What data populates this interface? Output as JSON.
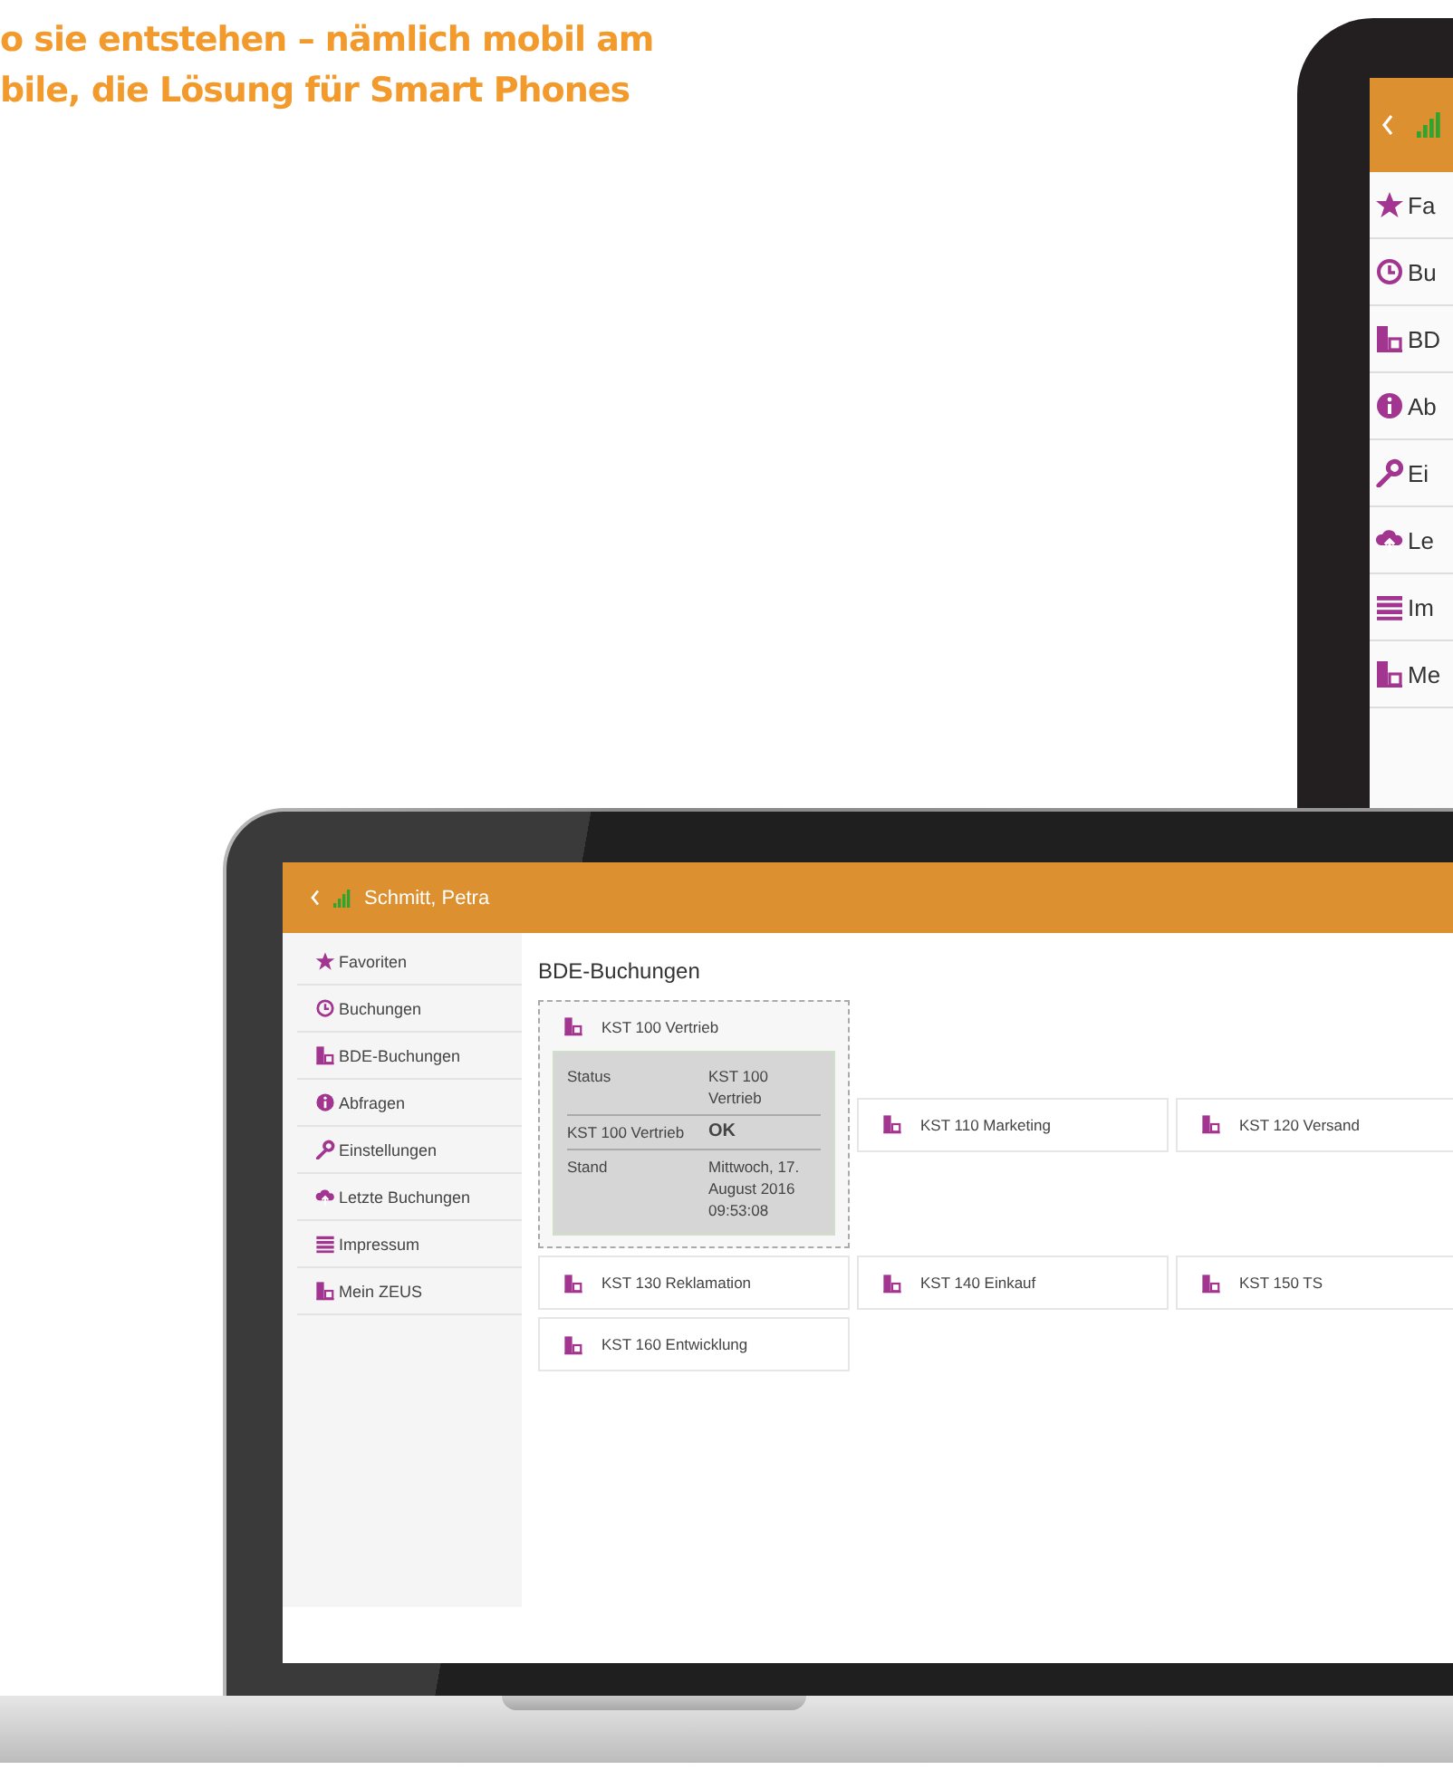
{
  "headline": [
    "o sie entstehen – nämlich mobil am",
    "bile, die Lösung für Smart Phones"
  ],
  "phone": {
    "menu": [
      {
        "label": "Fa"
      },
      {
        "label": "Bu"
      },
      {
        "label": "BD"
      },
      {
        "label": "Ab"
      },
      {
        "label": "Ei"
      },
      {
        "label": "Le"
      },
      {
        "label": "Im"
      },
      {
        "label": "Me"
      }
    ]
  },
  "laptop": {
    "user": "Schmitt, Petra",
    "menu": [
      {
        "label": "Favoriten"
      },
      {
        "label": "Buchungen"
      },
      {
        "label": "BDE-Buchungen"
      },
      {
        "label": "Abfragen"
      },
      {
        "label": "Einstellungen"
      },
      {
        "label": "Letzte Buchungen"
      },
      {
        "label": "Impressum"
      },
      {
        "label": "Mein ZEUS"
      }
    ],
    "title": "BDE-Buchungen",
    "tiles": [
      {
        "label": "KST 100 Vertrieb",
        "expanded": true,
        "details": [
          {
            "key": "Status",
            "value": "KST 100 Vertrieb",
            "kind": "text"
          },
          {
            "key": "KST 100 Vertrieb",
            "value": "OK",
            "kind": "status"
          },
          {
            "key": "Stand",
            "value": "Mittwoch, 17. August 2016 09:53:08",
            "kind": "text"
          }
        ]
      },
      {
        "label": "KST 110 Marketing",
        "expanded": false
      },
      {
        "label": "KST 120 Versand",
        "expanded": false
      },
      {
        "label": "KST 130 Reklamation",
        "expanded": false
      },
      {
        "label": "KST 140 Einkauf",
        "expanded": false
      },
      {
        "label": "KST 150 TS",
        "expanded": false
      },
      {
        "label": "KST 160 Entwicklung",
        "expanded": false
      }
    ]
  }
}
